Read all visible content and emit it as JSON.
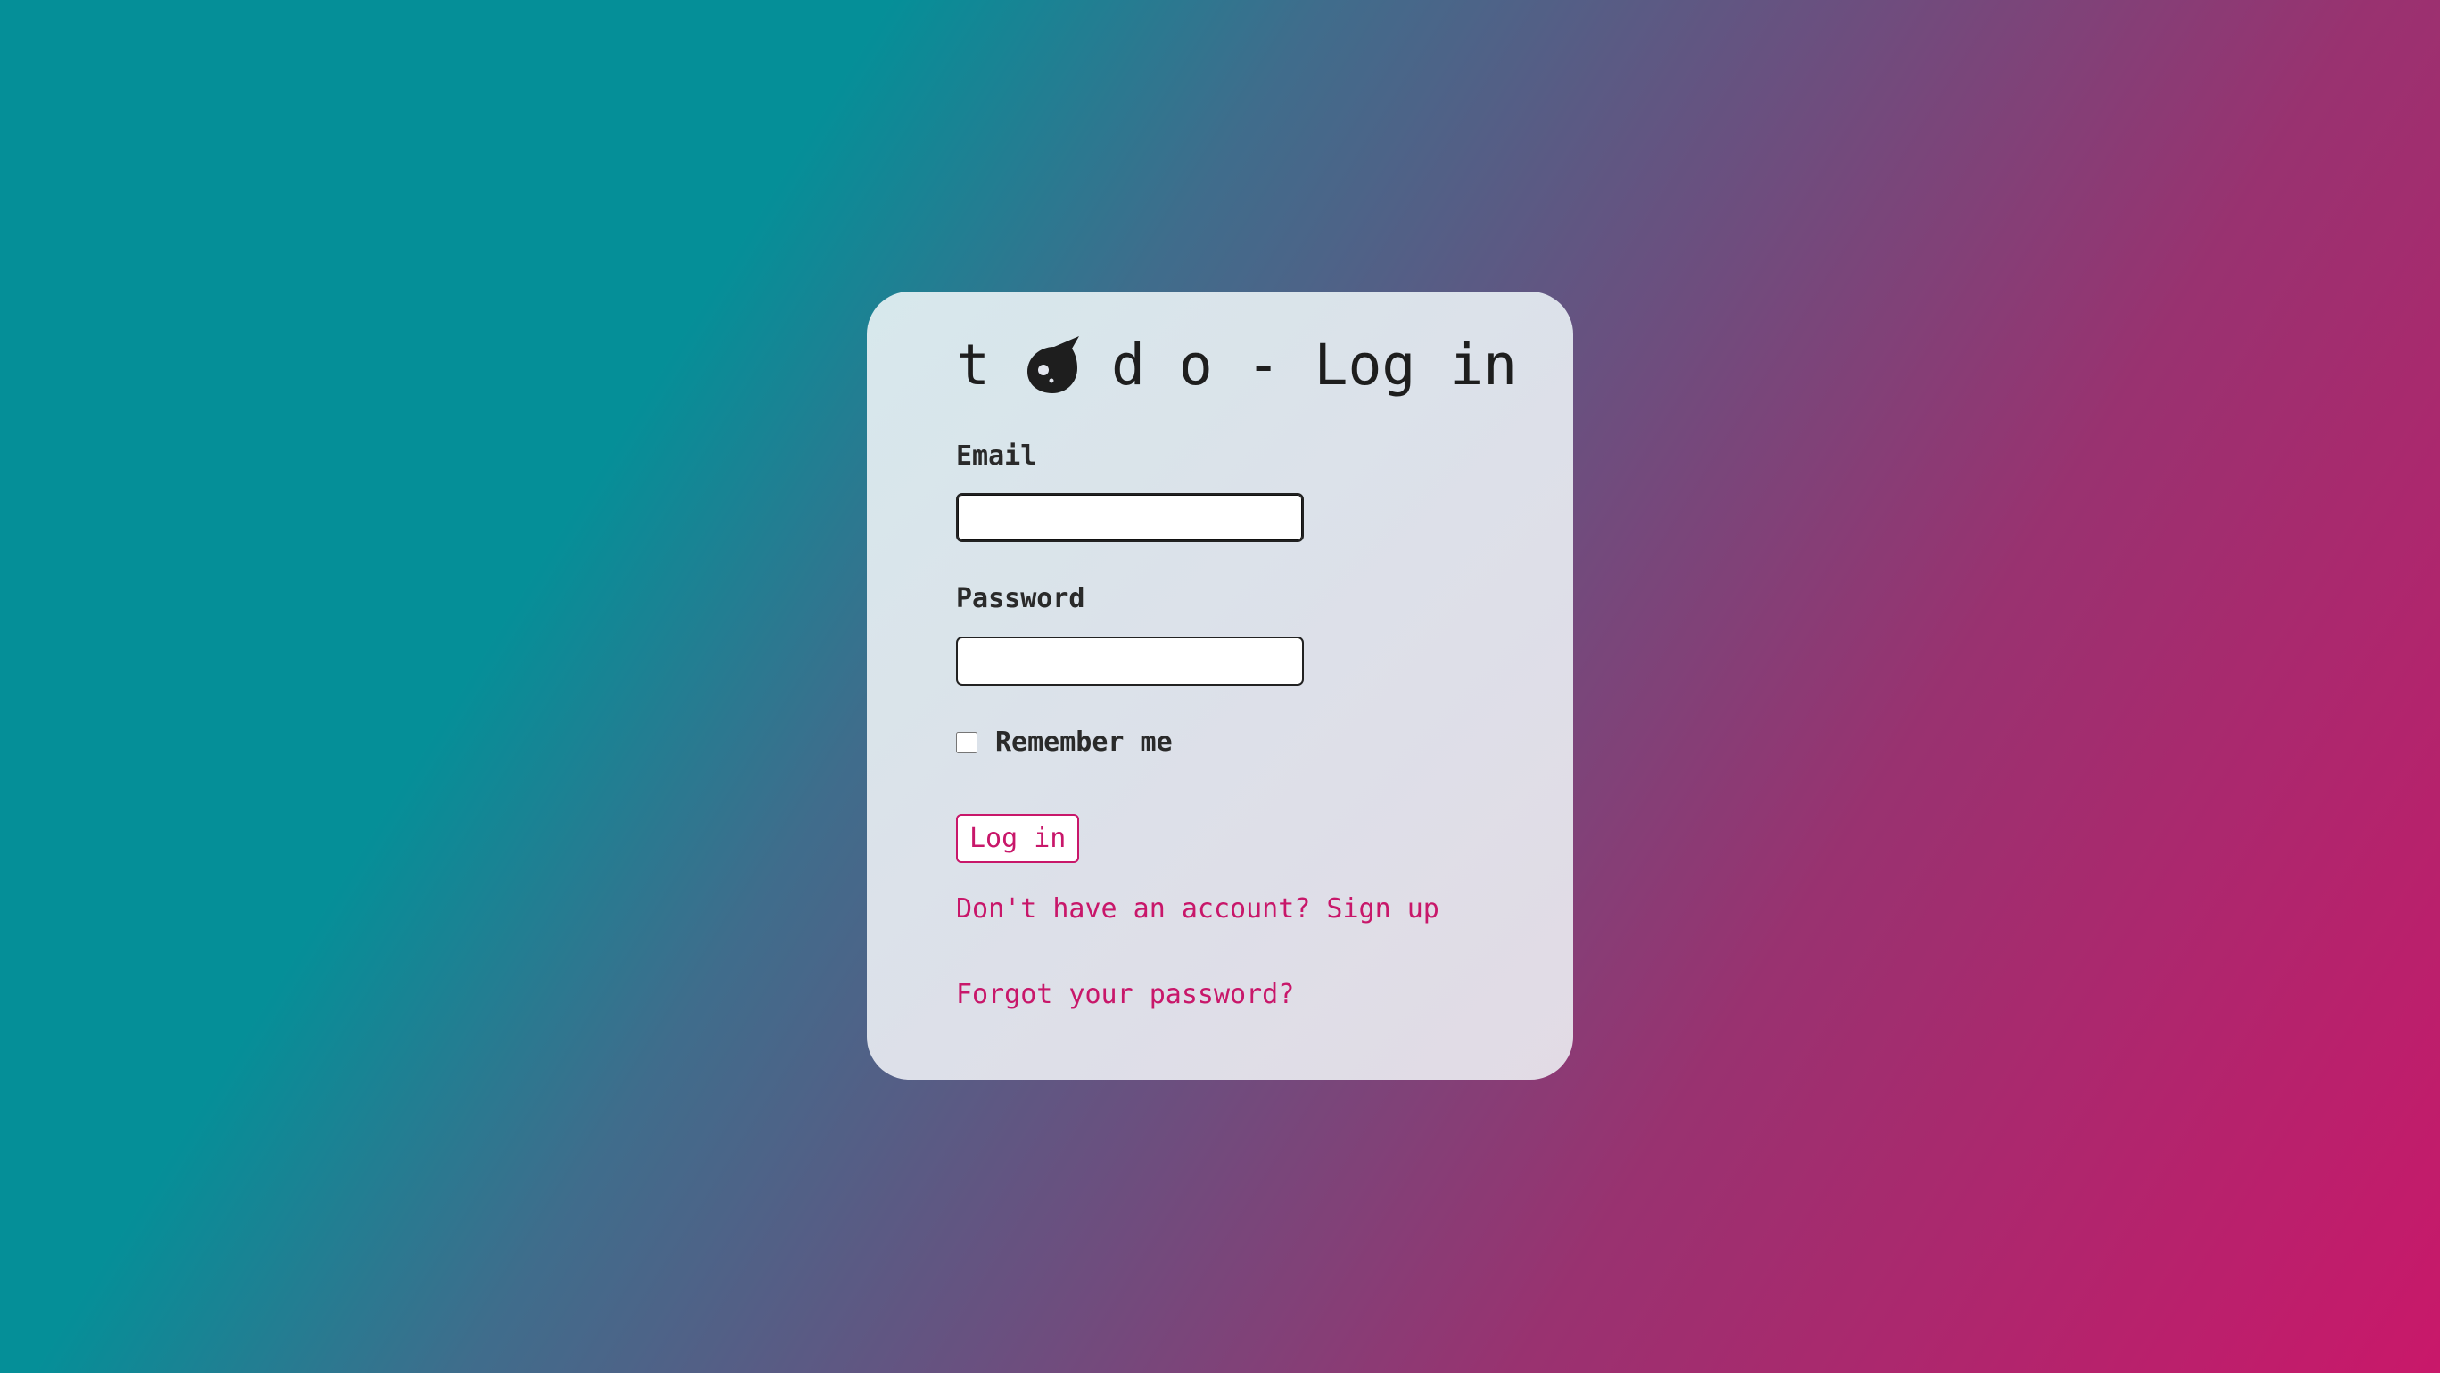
{
  "login_form": {
    "title_prefix": "t",
    "title_suffix": "d o - Log in",
    "logo_icon": "comet-logo-icon",
    "email_label": "Email",
    "email_value": "",
    "password_label": "Password",
    "password_value": "",
    "remember_label": "Remember me",
    "remember_checked": false,
    "submit_label": "Log in",
    "signup_link": "Don't have an account? Sign up",
    "forgot_link": "Forgot your password?"
  },
  "colors": {
    "accent": "#c8176a",
    "background_start": "#058f98",
    "background_end": "#c9186a",
    "card": "#dde2ea",
    "text": "#222222"
  }
}
